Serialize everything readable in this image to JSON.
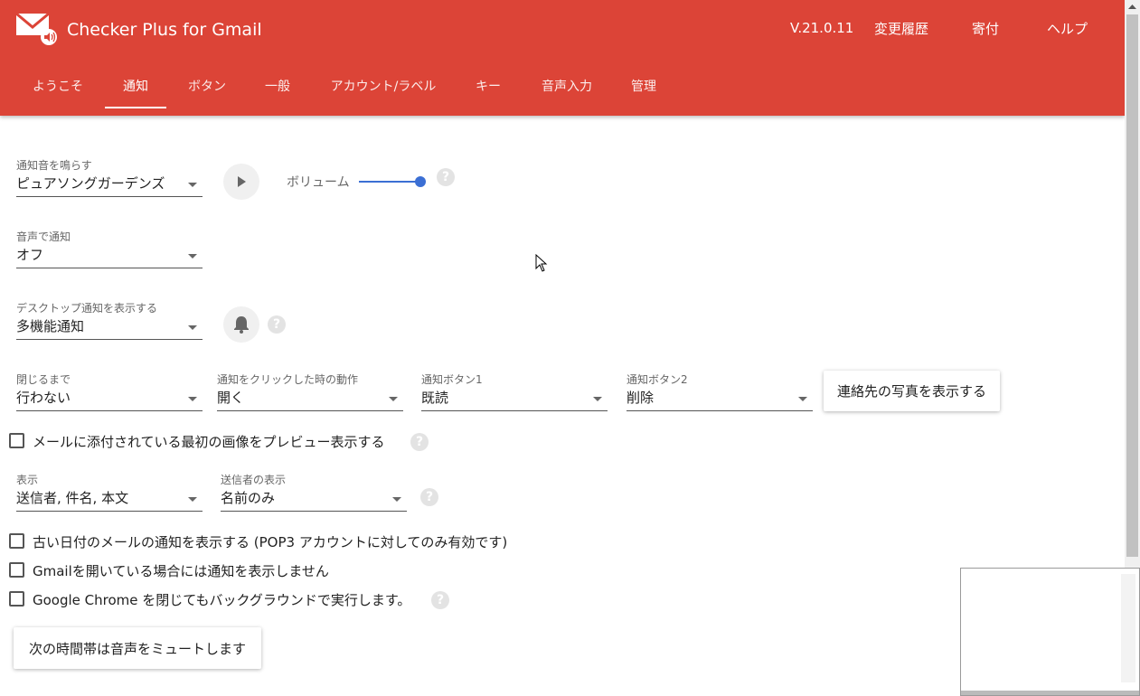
{
  "app": {
    "title": "Checker Plus for Gmail",
    "version": "V.21.0.11",
    "brand_color": "#dc4437"
  },
  "header_links": {
    "changelog": "変更履歴",
    "donate": "寄付",
    "help": "ヘルプ"
  },
  "tabs": [
    {
      "label": "ようこそ",
      "active": false
    },
    {
      "label": "通知",
      "active": true
    },
    {
      "label": "ボタン",
      "active": false
    },
    {
      "label": "一般",
      "active": false
    },
    {
      "label": "アカウント/ラベル",
      "active": false
    },
    {
      "label": "キー",
      "active": false
    },
    {
      "label": "音声入力",
      "active": false
    },
    {
      "label": "管理",
      "active": false
    }
  ],
  "notification_sound": {
    "label": "通知音を鳴らす",
    "value": "ピュアソングガーデンズ"
  },
  "volume": {
    "label": "ボリューム",
    "level": 1.0
  },
  "voice_notification": {
    "label": "音声で通知",
    "value": "オフ"
  },
  "desktop_notification": {
    "label": "デスクトップ通知を表示する",
    "value": "多機能通知"
  },
  "until_close": {
    "label": "閉じるまで",
    "value": "行わない"
  },
  "click_action": {
    "label": "通知をクリックした時の動作",
    "value": "開く"
  },
  "notif_button1": {
    "label": "通知ボタン1",
    "value": "既読"
  },
  "notif_button2": {
    "label": "通知ボタン2",
    "value": "削除"
  },
  "contact_photo_button": "連絡先の写真を表示する",
  "checkbox_preview_image": {
    "label": "メールに添付されている最初の画像をプレビュー表示する",
    "checked": false
  },
  "display": {
    "label": "表示",
    "value": "送信者, 件名, 本文"
  },
  "sender_display": {
    "label": "送信者の表示",
    "value": "名前のみ"
  },
  "checkbox_old_mail": {
    "label": "古い日付のメールの通知を表示する (POP3 アカウントに対してのみ有効です)",
    "checked": false
  },
  "checkbox_gmail_open": {
    "label": "Gmailを開いている場合には通知を表示しません",
    "checked": false
  },
  "checkbox_background": {
    "label": "Google Chrome を閉じてもバックグラウンドで実行します。",
    "checked": false
  },
  "mute_button": "次の時間帯は音声をミュートします",
  "help_glyph": "?",
  "accent_color": "#3b6fd4"
}
